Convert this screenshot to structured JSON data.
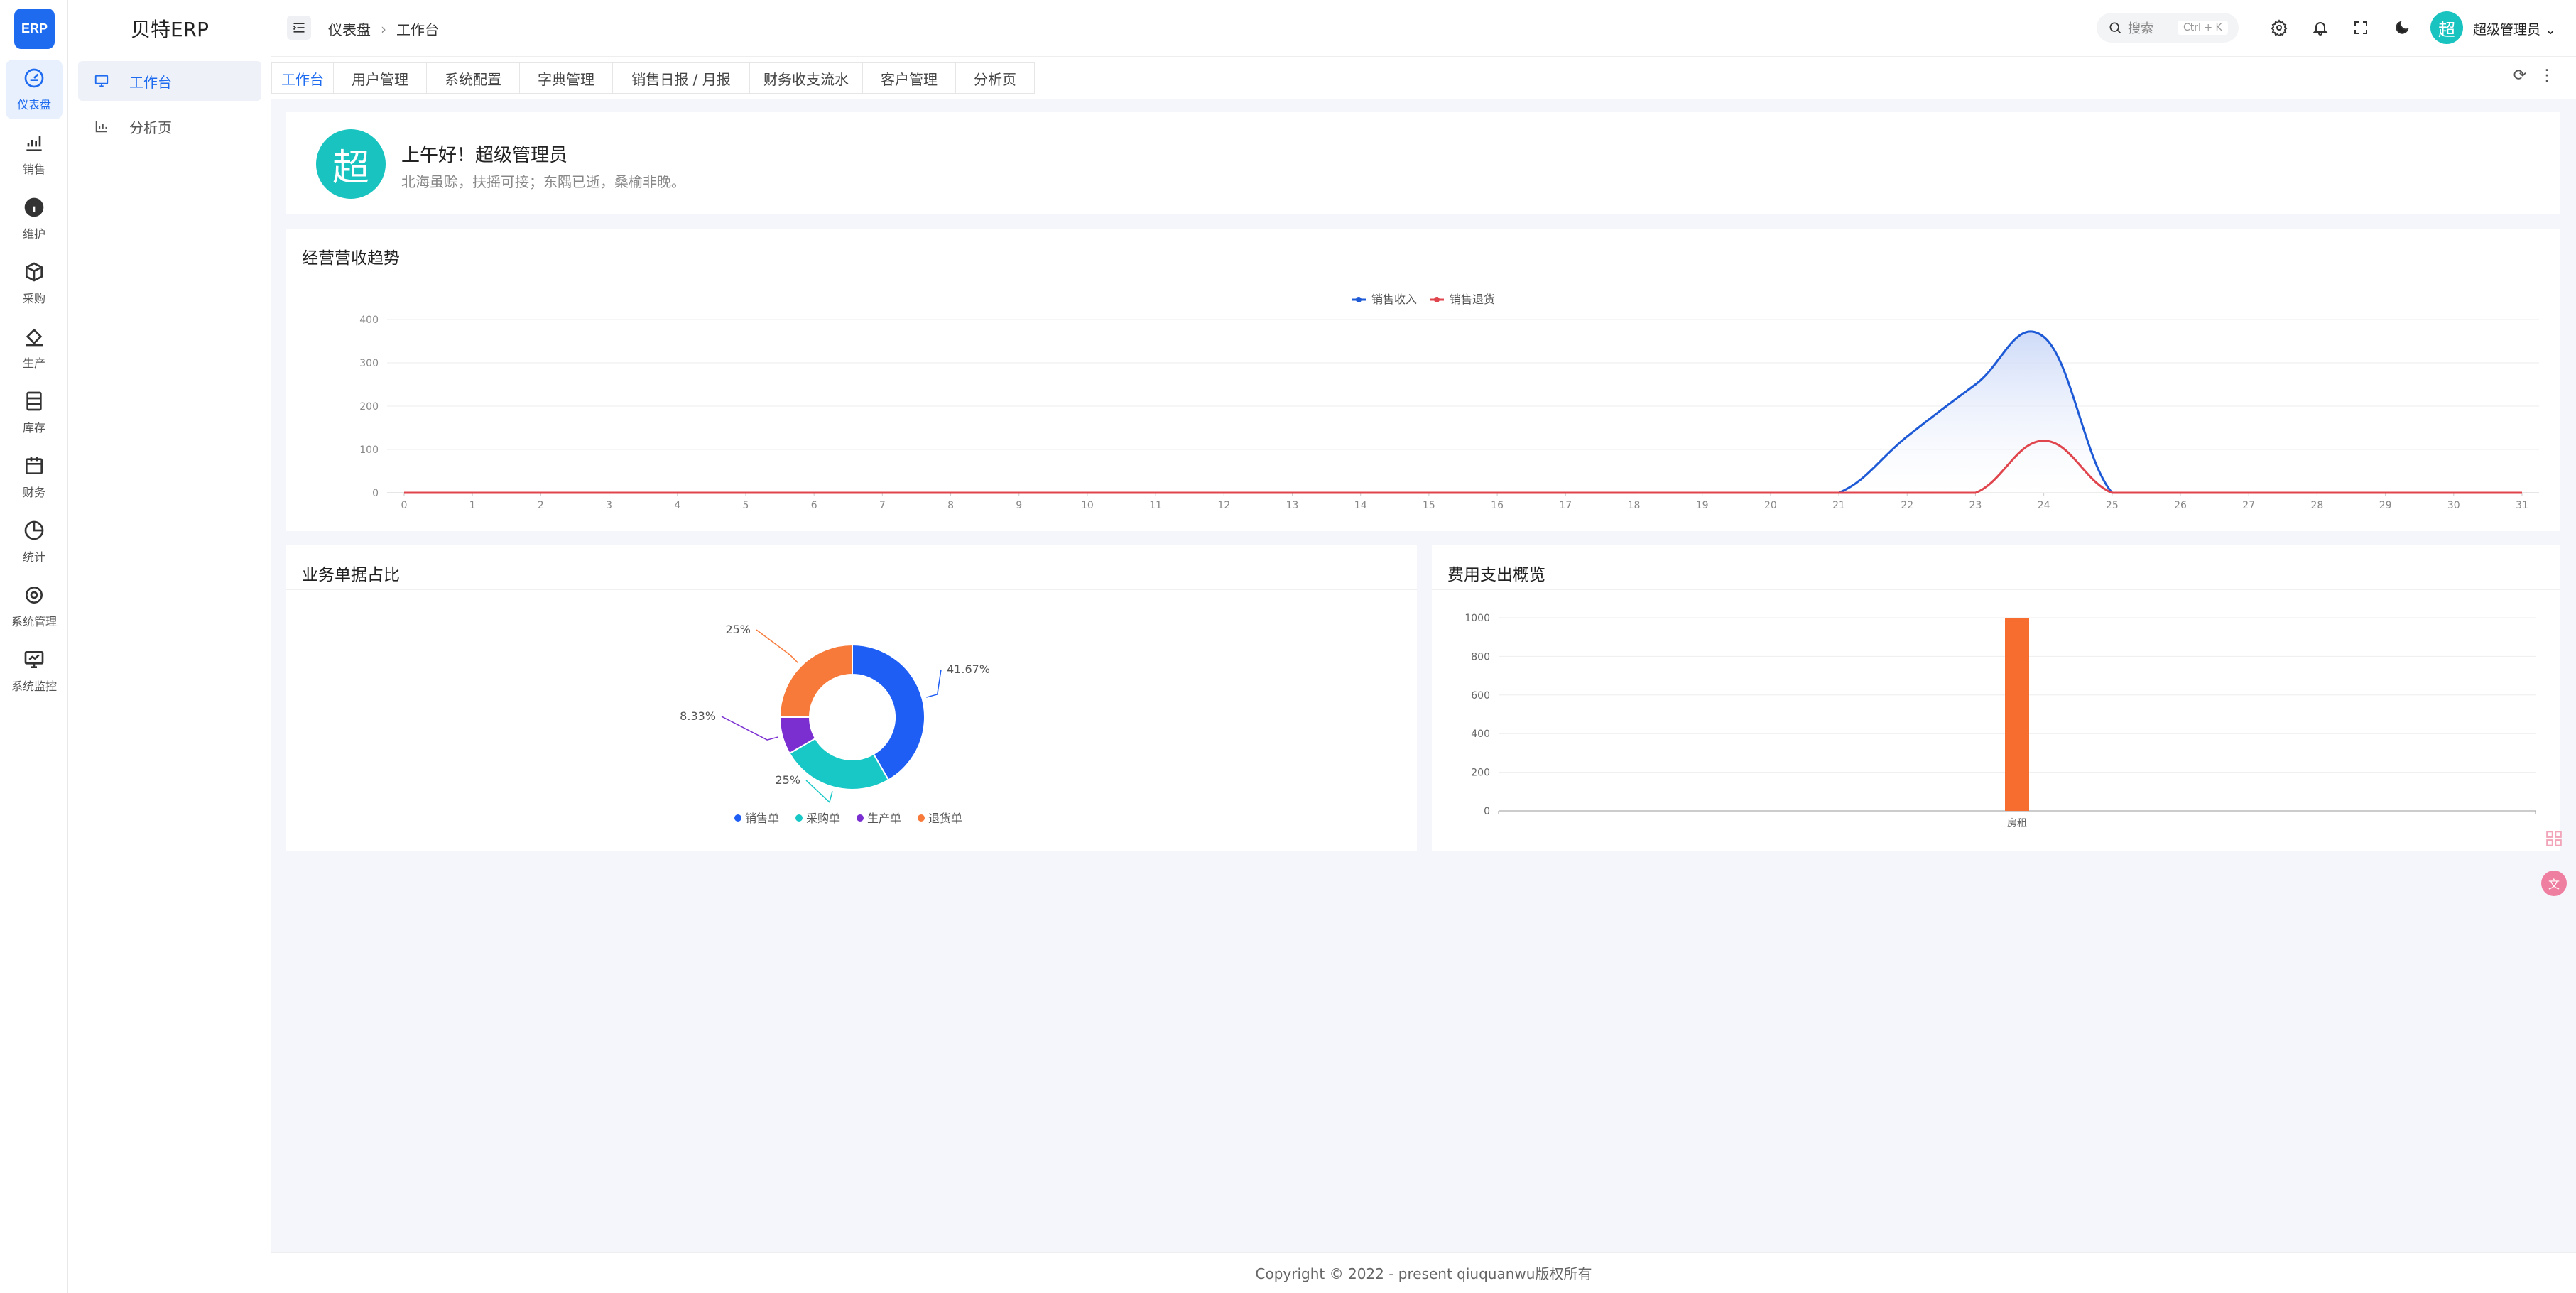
{
  "app": {
    "logo_text": "ERP",
    "brand": "贝特ERP"
  },
  "rail": [
    {
      "label": "仪表盘",
      "icon": "dashboard-icon",
      "active": true
    },
    {
      "label": "销售",
      "icon": "bar-chart-icon"
    },
    {
      "label": "维护",
      "icon": "info-icon"
    },
    {
      "label": "采购",
      "icon": "box-icon"
    },
    {
      "label": "生产",
      "icon": "paint-bucket-icon"
    },
    {
      "label": "库存",
      "icon": "inventory-icon"
    },
    {
      "label": "财务",
      "icon": "calendar-icon"
    },
    {
      "label": "统计",
      "icon": "pie-chart-icon"
    },
    {
      "label": "系统管理",
      "icon": "gear-icon"
    },
    {
      "label": "系统监控",
      "icon": "monitor-icon"
    }
  ],
  "submenu": [
    {
      "label": "工作台",
      "icon": "monitor-icon",
      "active": true
    },
    {
      "label": "分析页",
      "icon": "chart-icon"
    }
  ],
  "breadcrumb": [
    "仪表盘",
    "工作台"
  ],
  "header": {
    "search_placeholder": "搜索",
    "search_shortcut": "Ctrl + K",
    "avatar_char": "超",
    "username": "超级管理员"
  },
  "tabs": [
    "工作台",
    "用户管理",
    "系统配置",
    "字典管理",
    "销售日报 / 月报",
    "财务收支流水",
    "客户管理",
    "分析页"
  ],
  "welcome": {
    "avatar_char": "超",
    "greeting": "上午好！超级管理员",
    "motto": "北海虽赊，扶摇可接；东隅已逝，桑榆非晚。"
  },
  "trend": {
    "title": "经营营收趋势"
  },
  "share": {
    "title": "业务单据占比"
  },
  "expense": {
    "title": "费用支出概览"
  },
  "footer": "Copyright © 2022 - present qiuquanwu版权所有",
  "chart_data": [
    {
      "type": "area",
      "title": "经营营收趋势",
      "x": [
        0,
        1,
        2,
        3,
        4,
        5,
        6,
        7,
        8,
        9,
        10,
        11,
        12,
        13,
        14,
        15,
        16,
        17,
        18,
        19,
        20,
        21,
        22,
        23,
        24,
        25,
        26,
        27,
        28,
        29,
        30,
        31
      ],
      "ylim": [
        0,
        400
      ],
      "yticks": [
        0,
        100,
        200,
        300,
        400
      ],
      "series": [
        {
          "name": "销售收入",
          "color": "#1e5ad6",
          "values": [
            0,
            0,
            0,
            0,
            0,
            0,
            0,
            0,
            0,
            0,
            0,
            0,
            0,
            0,
            0,
            0,
            0,
            0,
            0,
            0,
            0,
            0,
            130,
            250,
            360,
            0,
            0,
            0,
            0,
            0,
            0,
            0
          ]
        },
        {
          "name": "销售退货",
          "color": "#e0454d",
          "values": [
            0,
            0,
            0,
            0,
            0,
            0,
            0,
            0,
            0,
            0,
            0,
            0,
            0,
            0,
            0,
            0,
            0,
            0,
            0,
            0,
            0,
            0,
            0,
            0,
            120,
            0,
            0,
            0,
            0,
            0,
            0,
            0
          ]
        }
      ],
      "legend": "top-center"
    },
    {
      "type": "pie",
      "title": "业务单据占比",
      "slices": [
        {
          "name": "销售单",
          "value": 41.67,
          "label": "41.67%",
          "color": "#1e5ef5"
        },
        {
          "name": "采购单",
          "value": 25,
          "label": "25%",
          "color": "#17c8c6"
        },
        {
          "name": "生产单",
          "value": 8.33,
          "label": "8.33%",
          "color": "#7b2fd1"
        },
        {
          "name": "退货单",
          "value": 25,
          "label": "25%",
          "color": "#f77a3a"
        }
      ],
      "legend": "bottom-center"
    },
    {
      "type": "bar",
      "title": "费用支出概览",
      "categories": [
        "房租"
      ],
      "values": [
        1000
      ],
      "ylim": [
        0,
        1000
      ],
      "yticks": [
        0,
        200,
        400,
        600,
        800,
        1000
      ],
      "color": "#f76d2f"
    }
  ]
}
